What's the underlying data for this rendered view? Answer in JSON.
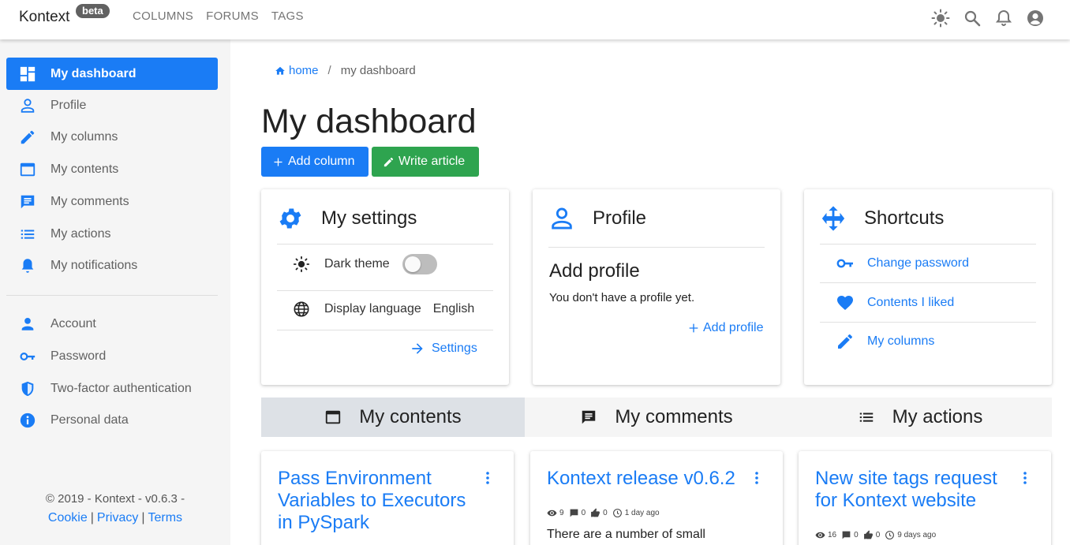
{
  "app": {
    "name": "Kontext",
    "badge": "beta"
  },
  "topnav": [
    "COLUMNS",
    "FORUMS",
    "TAGS"
  ],
  "top_icons": [
    "theme-icon",
    "search-icon",
    "bell-icon",
    "account-circle-icon"
  ],
  "sidebar": {
    "items": [
      {
        "label": "My dashboard",
        "icon": "dashboard-icon",
        "active": true
      },
      {
        "label": "Profile",
        "icon": "person-icon"
      },
      {
        "label": "My columns",
        "icon": "pencil-icon"
      },
      {
        "label": "My contents",
        "icon": "window-icon"
      },
      {
        "label": "My comments",
        "icon": "comment-icon"
      },
      {
        "label": "My actions",
        "icon": "list-icon"
      },
      {
        "label": "My notifications",
        "icon": "bell-icon"
      }
    ],
    "account_items": [
      {
        "label": "Account",
        "icon": "person-icon"
      },
      {
        "label": "Password",
        "icon": "key-icon"
      },
      {
        "label": "Two-factor authentication",
        "icon": "shield-icon"
      },
      {
        "label": "Personal data",
        "icon": "info-icon"
      }
    ],
    "footer": {
      "copyright": "© 2019 - Kontext - v0.6.3 -",
      "links": [
        "Cookie",
        "Privacy",
        "Terms"
      ]
    }
  },
  "breadcrumb": {
    "home": "home",
    "separator": "/",
    "current": "my dashboard"
  },
  "page_title": "My dashboard",
  "actions": {
    "add_column": "Add column",
    "write_article": "Write article"
  },
  "settings_card": {
    "title": "My settings",
    "dark_theme_label": "Dark theme",
    "dark_theme_on": false,
    "language_label": "Display language",
    "language_value": "English",
    "link": "Settings"
  },
  "profile_card": {
    "title": "Profile",
    "heading": "Add profile",
    "text": "You don't have a profile yet.",
    "link": "Add profile"
  },
  "shortcuts_card": {
    "title": "Shortcuts",
    "links": [
      "Change password",
      "Contents I liked",
      "My columns"
    ]
  },
  "tabs": [
    {
      "label": "My contents",
      "icon": "window-icon",
      "active": true
    },
    {
      "label": "My comments",
      "icon": "comment-icon"
    },
    {
      "label": "My actions",
      "icon": "list-icon"
    }
  ],
  "posts": [
    {
      "title": "Pass Environment Variables to Executors in PySpark"
    },
    {
      "title": "Kontext release v0.6.2",
      "views": "9",
      "comments": "0",
      "likes": "0",
      "time": "1 day ago",
      "excerpt": "There are a number of small"
    },
    {
      "title": "New site tags request for Kontext website",
      "views": "16",
      "comments": "0",
      "likes": "0",
      "time": "9 days ago"
    }
  ],
  "colors": {
    "primary": "#1a7cf5",
    "success": "#2ea44f",
    "sidebar_bg": "#f5f5f5"
  }
}
